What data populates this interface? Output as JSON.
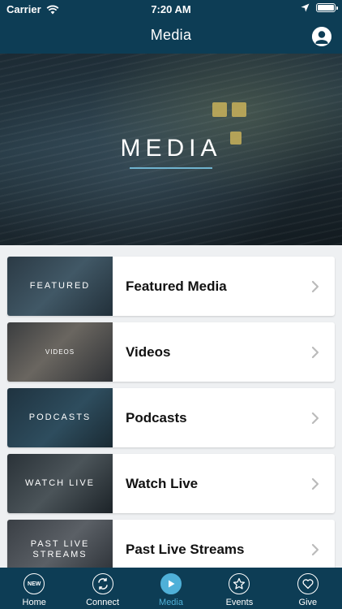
{
  "status_bar": {
    "carrier": "Carrier",
    "time": "7:20 AM"
  },
  "nav": {
    "title": "Media"
  },
  "hero": {
    "title": "MEDIA"
  },
  "media_list": [
    {
      "thumb_label": "FEATURED",
      "label": "Featured Media"
    },
    {
      "thumb_label": "VIDEOS",
      "label": "Videos"
    },
    {
      "thumb_label": "PODCASTS",
      "label": "Podcasts"
    },
    {
      "thumb_label": "WATCH LIVE",
      "label": "Watch Live"
    },
    {
      "thumb_label": "PAST LIVE STREAMS",
      "label": "Past Live Streams"
    }
  ],
  "tabs": [
    {
      "label": "Home",
      "icon": "new-icon",
      "badge": "NEW"
    },
    {
      "label": "Connect",
      "icon": "connect-icon"
    },
    {
      "label": "Media",
      "icon": "play-icon"
    },
    {
      "label": "Events",
      "icon": "star-icon"
    },
    {
      "label": "Give",
      "icon": "heart-icon"
    }
  ],
  "colors": {
    "bar_bg": "#0d3d55",
    "accent": "#4fb0d8"
  }
}
